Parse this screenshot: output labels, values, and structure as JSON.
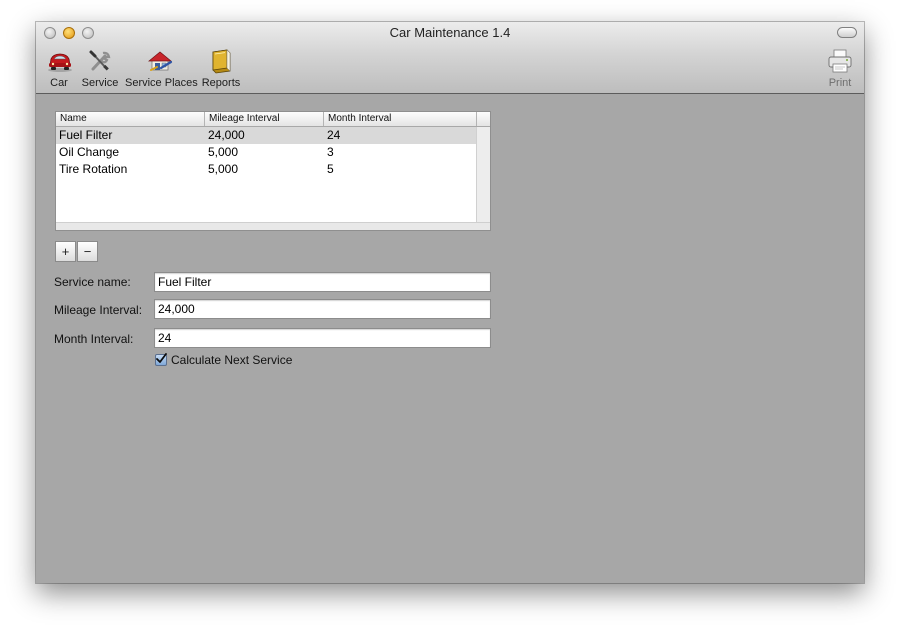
{
  "window": {
    "title": "Car Maintenance 1.4"
  },
  "toolbar": {
    "items": [
      {
        "label": "Car",
        "icon": "car-icon"
      },
      {
        "label": "Service",
        "icon": "wrench-screwdriver-icon"
      },
      {
        "label": "Service Places",
        "icon": "house-icon"
      },
      {
        "label": "Reports",
        "icon": "book-icon"
      }
    ],
    "print": {
      "label": "Print",
      "icon": "printer-icon"
    }
  },
  "table": {
    "columns": [
      "Name",
      "Mileage Interval",
      "Month Interval"
    ],
    "rows": [
      {
        "name": "Fuel Filter",
        "mileage": "24,000",
        "month": "24",
        "selected": true
      },
      {
        "name": "Oil Change",
        "mileage": "5,000",
        "month": "3",
        "selected": false
      },
      {
        "name": "Tire Rotation",
        "mileage": "5,000",
        "month": "5",
        "selected": false
      }
    ]
  },
  "buttons": {
    "add": "+",
    "remove": "−"
  },
  "form": {
    "service_name_label": "Service name:",
    "service_name_value": "Fuel Filter",
    "mileage_label": "Mileage Interval:",
    "mileage_value": "24,000",
    "month_label": "Month Interval:",
    "month_value": "24",
    "calc_label": "Calculate Next Service",
    "calc_checked": true
  },
  "colors": {
    "window_bg": "#a7a7a7",
    "selection": "#d9d9d9",
    "min_button": "#f0a81e"
  }
}
